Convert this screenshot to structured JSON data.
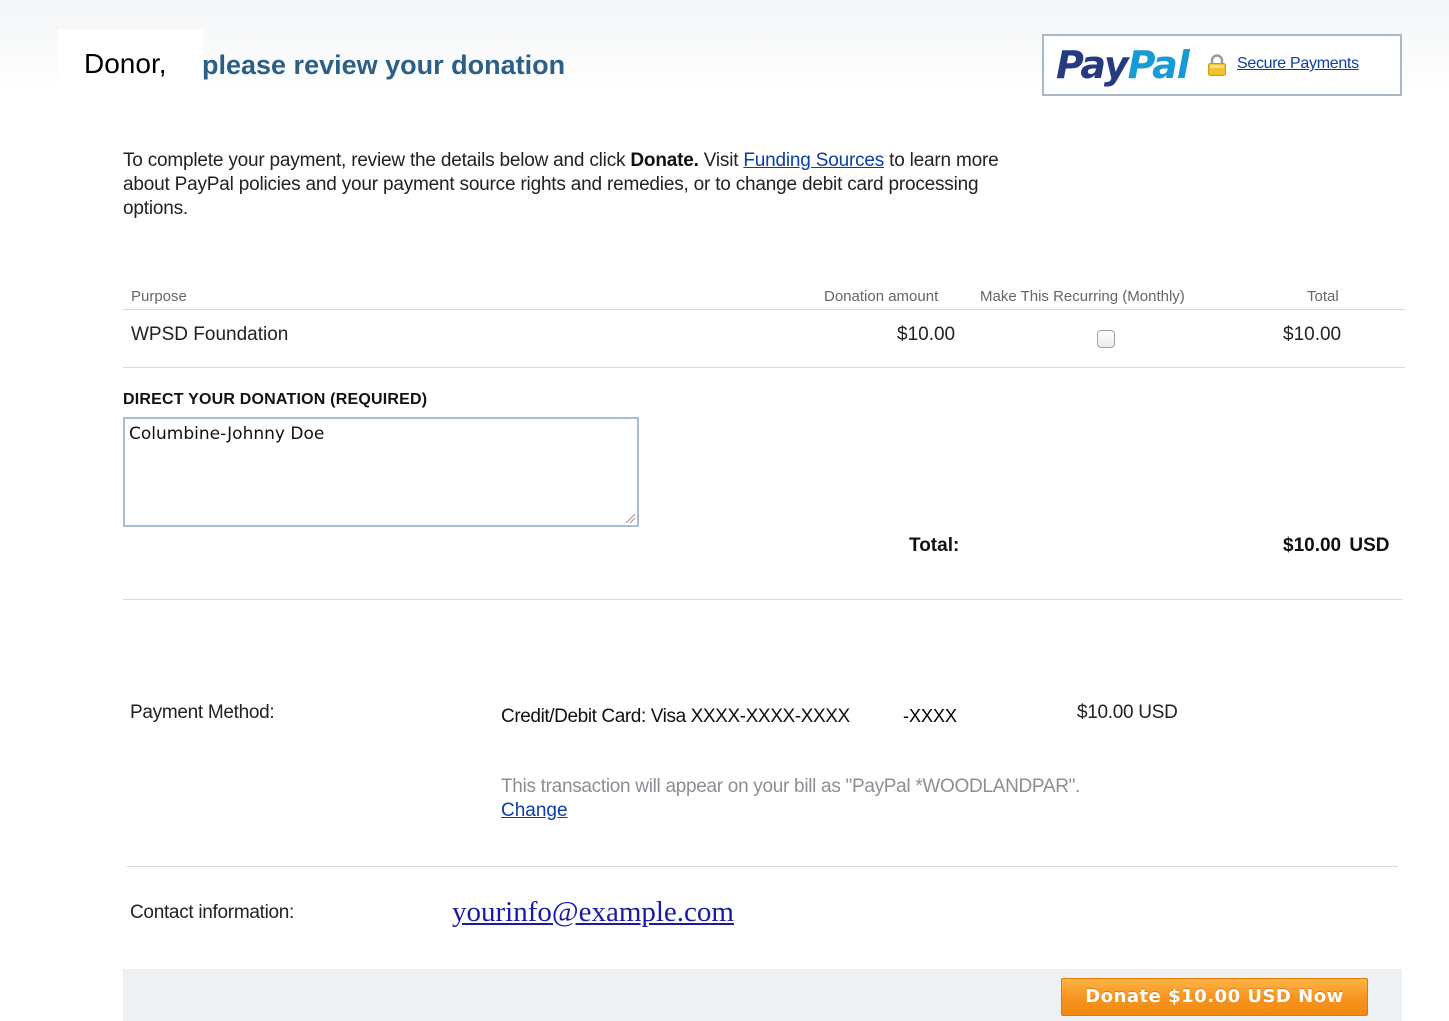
{
  "header": {
    "greeting_name": "Donor,",
    "title": "please review your donation",
    "logo_pay": "Pay",
    "logo_pal": "Pal",
    "secure_link": "Secure Payments"
  },
  "intro": {
    "text_1": "To complete your payment, review the details below and click ",
    "bold": "Donate.",
    "text_2": " Visit ",
    "link": "Funding Sources",
    "text_3": " to learn more about PayPal policies and your payment source rights and remedies, or to change debit card processing options."
  },
  "table": {
    "headers": {
      "purpose": "Purpose",
      "amount": "Donation amount",
      "recurring": "Make This Recurring (Monthly)",
      "total": "Total"
    },
    "row": {
      "purpose": "WPSD Foundation",
      "amount": "$10.00",
      "recurring_checked": false,
      "total": "$10.00"
    }
  },
  "direction": {
    "label": "DIRECT YOUR DONATION (REQUIRED)",
    "value": "Columbine-Johnny Doe"
  },
  "totals": {
    "label": "Total:",
    "value": "$10.00  USD"
  },
  "payment": {
    "label": "Payment Method:",
    "card": "Credit/Debit Card: Visa XXXX-XXXX-XXXX",
    "card_last": "-XXXX",
    "amount": "$10.00 USD",
    "note": "This transaction will appear on your bill as \"PayPal *WOODLANDPAR\".",
    "change": "Change"
  },
  "contact": {
    "label": "Contact information:",
    "email": "yourinfo@example.com"
  },
  "donate_button": "Donate $10.00 USD Now",
  "colors": {
    "title_blue": "#2b5f87",
    "link_blue": "#0b3ea8",
    "paypal_dark": "#253b80",
    "paypal_light": "#179bd7",
    "button_orange": "#f7931e"
  }
}
